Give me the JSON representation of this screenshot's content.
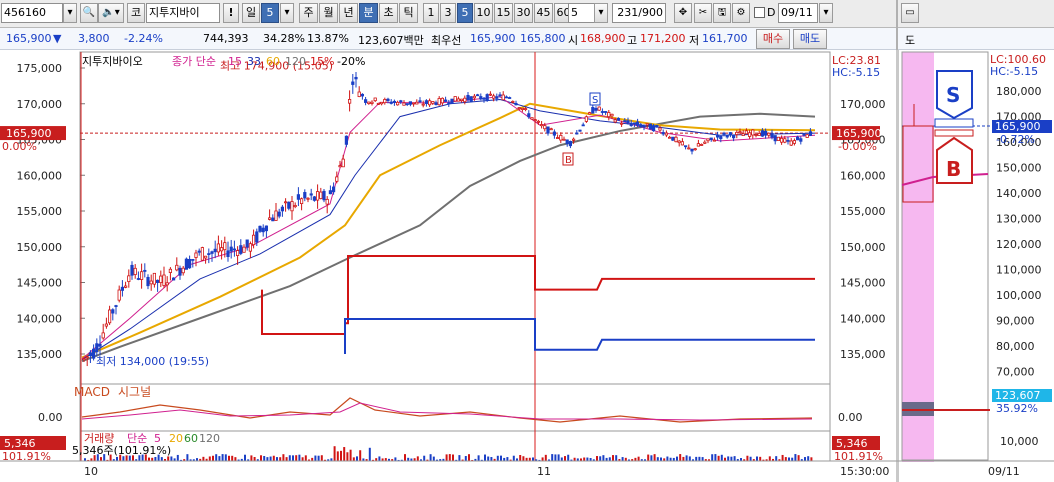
{
  "toolbar": {
    "stock_code": "456160",
    "market_label": "코",
    "stock_name": "지투지바이",
    "warning_label": "!",
    "period_label": "일",
    "period_value": "5",
    "tf_buttons": [
      "주",
      "월",
      "년",
      "분",
      "초",
      "틱"
    ],
    "active_tf": "분",
    "interval_buttons": [
      "1",
      "3",
      "5",
      "10",
      "15",
      "30",
      "45",
      "60"
    ],
    "active_interval": "5",
    "interval_input": "5",
    "count": "231",
    "count_total": "/900",
    "hide_label": "D",
    "date": "09/11"
  },
  "quote": {
    "price": "165,900",
    "dir_icon": "▼",
    "change": "3,800",
    "change_pct": "-2.24%",
    "volume": "744,393",
    "turnover_pct": "34.28%",
    "ratio_pct": "13.87%",
    "amount": "123,607백만",
    "best_label": "최우선",
    "best_ask": "165,900",
    "best_bid": "165,800",
    "open_label": "시",
    "open": "168,900",
    "high_label": "고",
    "high": "171,200",
    "low_label": "저",
    "low": "161,700",
    "buy_button": "매수",
    "sell_button": "매도"
  },
  "main": {
    "legend": {
      "name": "지투지바이오",
      "ma_label": "종가 단순",
      "ma": [
        "15",
        "33",
        "60",
        "120"
      ],
      "env": [
        "-15%",
        "-20%"
      ]
    },
    "high_annot": "최고 174,900 (15:05)",
    "low_annot": "최저 134,000 (19:55)",
    "lc": "LC:23.81",
    "hc": "HC:-5.15",
    "cur_price": "165,900",
    "cur_pct": "0.00%",
    "right_pct": "-0.00%",
    "y_labels": [
      "175,000",
      "170,000",
      "165,000",
      "160,000",
      "155,000",
      "150,000",
      "145,000",
      "140,000",
      "135,000"
    ],
    "y_labels_right": [
      "170,000",
      "165,000",
      "160,000",
      "155,000",
      "150,000",
      "145,000",
      "140,000",
      "135,000"
    ],
    "s_marker": "S",
    "b_marker": "B"
  },
  "macd": {
    "title": "MACD",
    "signal": "시그널",
    "zero": "0.00"
  },
  "volume": {
    "title": "거래량",
    "ma_label": "단순",
    "ma": [
      "5",
      "20",
      "60",
      "120"
    ],
    "value": "5,346",
    "info": "5,346주(101.91%)",
    "pct": "101.91%"
  },
  "xaxis": {
    "labels": [
      "10",
      "11"
    ],
    "time": "15:30:00"
  },
  "side": {
    "tab": "도",
    "lc": "LC:100.60",
    "hc": "HC:-5.15",
    "y_labels": [
      "180,000",
      "170,000",
      "160,000",
      "150,000",
      "140,000",
      "130,000",
      "120,000",
      "110,000",
      "100,000",
      "90,000",
      "80,000",
      "70,000"
    ],
    "price": "165,900",
    "pct": "-0.72%",
    "vol_value": "123,607",
    "vol_pct": "35.92%",
    "vol_label": "10,000",
    "s_marker": "S",
    "b_marker": "B",
    "date": "09/11"
  },
  "colors": {
    "up": "#d11414",
    "down": "#1a3fc6",
    "ma15": "#d0208f",
    "ma33": "#1a2fae",
    "ma60": "#e8a800",
    "ma120": "#707070"
  }
}
